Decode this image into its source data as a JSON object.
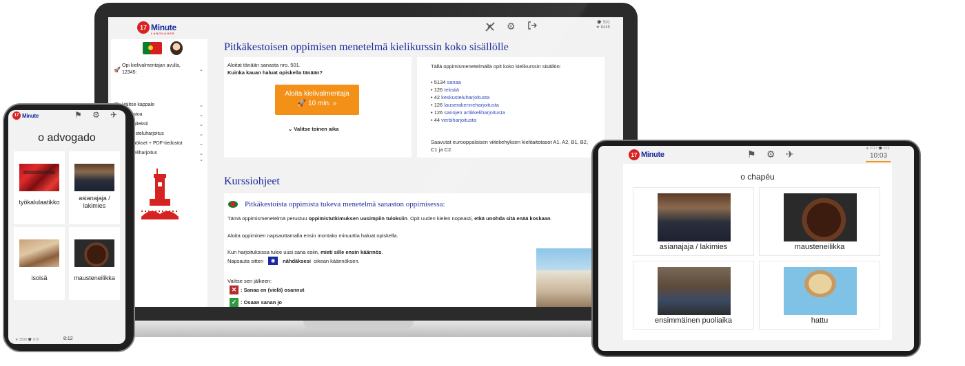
{
  "brand": {
    "logo_number": "17",
    "logo_word": "Minute",
    "logo_sub": "LANGUAGES",
    "red": "#d72222",
    "blue": "#1a2a9c",
    "orange": "#f39018"
  },
  "laptop": {
    "stats": {
      "cap_count": "501",
      "star_count": "8445"
    },
    "sidebar": {
      "items": [
        {
          "icon": "rocket-icon",
          "label": "Opi kielivalmentajan avulla, 12345:"
        },
        {
          "icon": "list-icon",
          "label": "Valitse kappale"
        },
        {
          "icon": "puzzle-icon",
          "label": "Sanastoa"
        },
        {
          "icon": "dialog-icon",
          "label": "Dialogiteksti"
        },
        {
          "icon": "chat-icon",
          "label": "Keskusteluharjoitus"
        },
        {
          "icon": "book-icon",
          "label": "Käännökset + PDF-tiedostot"
        },
        {
          "icon": "article-icon",
          "label": "Artikkeliharjoitus"
        }
      ]
    },
    "main": {
      "title": "Pitkäkestoisen oppimisen menetelmä kielikurssin koko sisällölle",
      "left_card": {
        "line1": "Aloitat tänään sanasta nro. 501.",
        "line2": "Kuinka kauan haluat opiskella tänään?",
        "cta_line1": "Aloita kielivalmentaja",
        "cta_line2": "10 min.  »",
        "other_time": "Valitse toinen aika"
      },
      "right_card": {
        "intro": "Tällä oppimismenetelmällä opit koko kielikurssin sisällön:",
        "items": [
          {
            "count": "• 5134",
            "link": "sanaa"
          },
          {
            "count": "• 126",
            "link": "tekstiä"
          },
          {
            "count": "• 42",
            "link": "keskusteluharjoitusta"
          },
          {
            "count": "• 126",
            "link": "lauserakenneharjoitusta"
          },
          {
            "count": "• 126",
            "link": "sanojen artikkeliharjoitusta"
          },
          {
            "count": "• 44",
            "link": "verbiharjoitusta"
          }
        ],
        "footer_a": "Saavutat eurooppalaisen viitekehyksen kielitaitotasot A1, A2, B1, B2,",
        "footer_b": "C1 ja C2."
      },
      "section_title": "Kurssiohjeet",
      "guide": {
        "heading": "Pitkäkestoista oppimista tukeva menetelmä sanaston oppimisessa:",
        "p1_a": "Tämä oppimismenetelmä perustuu ",
        "p1_b": "oppimistutkimuksen uusimpiin tuloksiin",
        "p1_c": ". Opit uuden kielen nopeasti, ",
        "p1_d": "etkä unohda sitä enää koskaan",
        "p1_e": ".",
        "p2": "Aloita oppiminen napsauttamalla ensin montako minuuttia haluat opiskella.",
        "p3_a": "Kun harjoituksissa tulee uusi sana esiin, ",
        "p3_b": "mieti sille ensin käännös",
        "p3_c": ".",
        "p4_a": "Napsauta sitten",
        "p4_b": "nähdäksesi",
        "p4_c": " oikean käännöksen.",
        "p5": "Valitse sen jälkeen:",
        "opt1": ": Sanaa en (vielä) osannut",
        "opt2": ": Osaan sanan jo"
      }
    }
  },
  "phone": {
    "word": "o advogado",
    "tiles": [
      "työkalulaatikko",
      "asianajaja / lakimies",
      "isoisä",
      "mausteneilikka"
    ],
    "footer": {
      "stars": "3590",
      "caps": "670",
      "time": "8:12"
    }
  },
  "tablet": {
    "word": "o chapéu",
    "stats": {
      "stars": "2717",
      "caps": "670"
    },
    "time": "10:03",
    "tiles": [
      "asianajaja / lakimies",
      "mausteneilikka",
      "ensimmäinen puoliaika",
      "hattu"
    ]
  }
}
